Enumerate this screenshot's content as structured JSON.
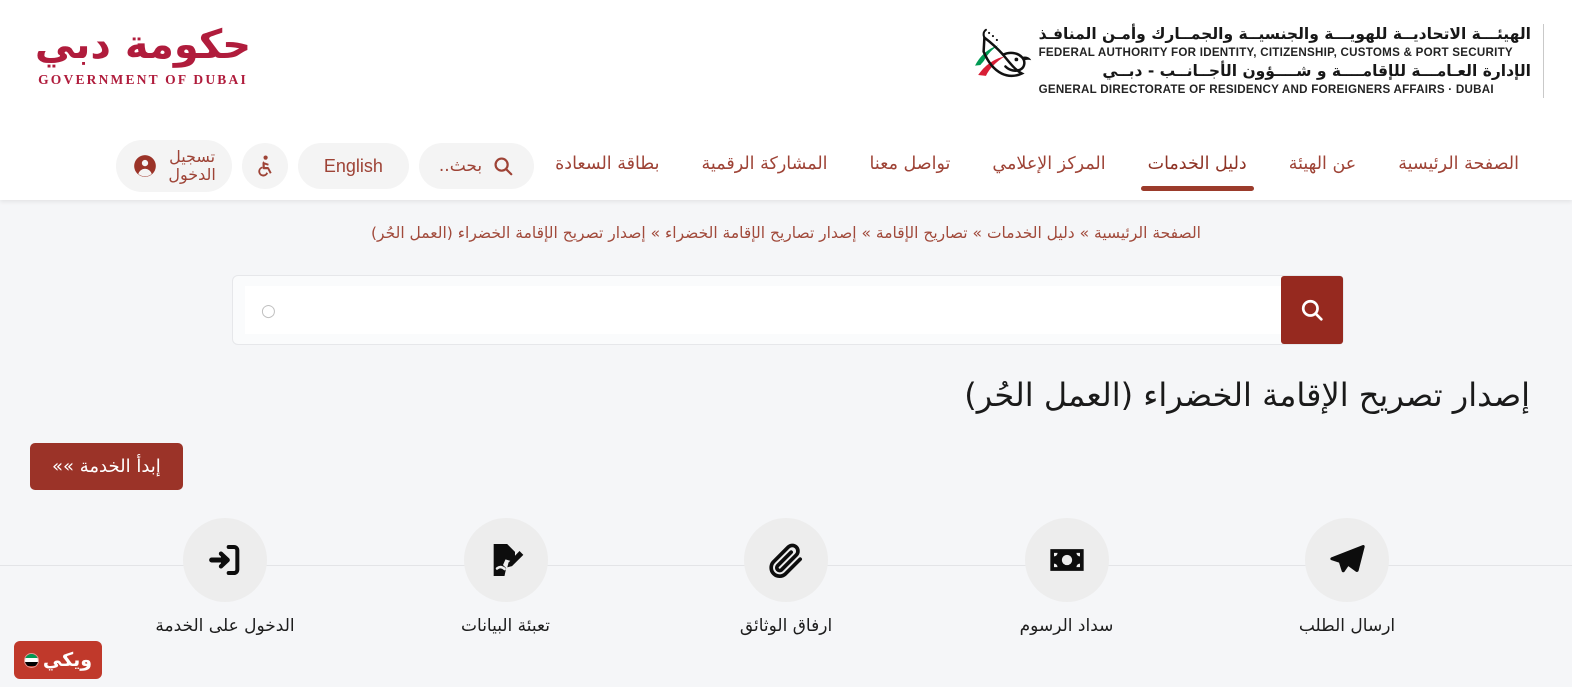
{
  "header": {
    "gov_logo": {
      "script_ar": "حكومة دبي",
      "name_en": "GOVERNMENT OF DUBAI"
    },
    "federal_logo": {
      "line1_ar": "الهيئـــة الاتحاديــة للهويـــة والجنسيــة والجمــارك وأمـن المنافـذ",
      "line1_en": "FEDERAL AUTHORITY FOR IDENTITY, CITIZENSHIP, CUSTOMS & PORT SECURITY",
      "line2_ar": "الإدارة العـامـــة للإقامــــة و شــــؤون الأجــانــب - دبــي",
      "line2_en": "GENERAL DIRECTORATE OF RESIDENCY AND FOREIGNERS AFFAIRS · DUBAI"
    }
  },
  "nav": {
    "items": [
      {
        "label": "الصفحة الرئيسية",
        "active": false
      },
      {
        "label": "عن الهيئة",
        "active": false
      },
      {
        "label": "دليل الخدمات",
        "active": true
      },
      {
        "label": "المركز الإعلامي",
        "active": false
      },
      {
        "label": "تواصل معنا",
        "active": false
      },
      {
        "label": "المشاركة الرقمية",
        "active": false
      },
      {
        "label": "بطاقة السعادة",
        "active": false
      }
    ],
    "tools": {
      "search_label": "بحث..",
      "search_icon": "search-icon",
      "language_label": "English",
      "accessibility_icon": "wheelchair-accessibility-icon",
      "login_label": "تسجيل\nالدخول",
      "login_icon": "user-account-icon"
    }
  },
  "breadcrumb": {
    "text": "الصفحة الرئيسية » دليل الخدمات » تصاريح الإقامة » إصدار تصاريح الإقامة الخضراء » إصدار تصريح الإقامة الخضراء (العمل الحُر)"
  },
  "search": {
    "value": "",
    "placeholder": "○",
    "button_icon": "search-icon"
  },
  "main": {
    "title": "إصدار تصريح الإقامة الخضراء (العمل الحُر)",
    "cta_label": "إبدأ الخدمة »»"
  },
  "steps": [
    {
      "label": "ارسال الطلب",
      "icon": "paper-plane-send-icon"
    },
    {
      "label": "سداد الرسوم",
      "icon": "banknote-payment-icon"
    },
    {
      "label": "ارفاق الوثائق",
      "icon": "paperclip-attachment-icon"
    },
    {
      "label": "تعبئة البيانات",
      "icon": "document-edit-icon"
    },
    {
      "label": "الدخول على الخدمة",
      "icon": "login-arrow-icon"
    }
  ],
  "watermark": {
    "text": "ويكي",
    "flag_icon": "uae-flag-icon"
  },
  "colors": {
    "brand_red": "#9b3328",
    "nav_red": "#9e4336",
    "search_button": "#96291f",
    "logo_crimson": "#b01c3c",
    "page_bg": "#f5f6f8",
    "circle_gray": "#ededed",
    "watermark_red": "#c0392b"
  }
}
